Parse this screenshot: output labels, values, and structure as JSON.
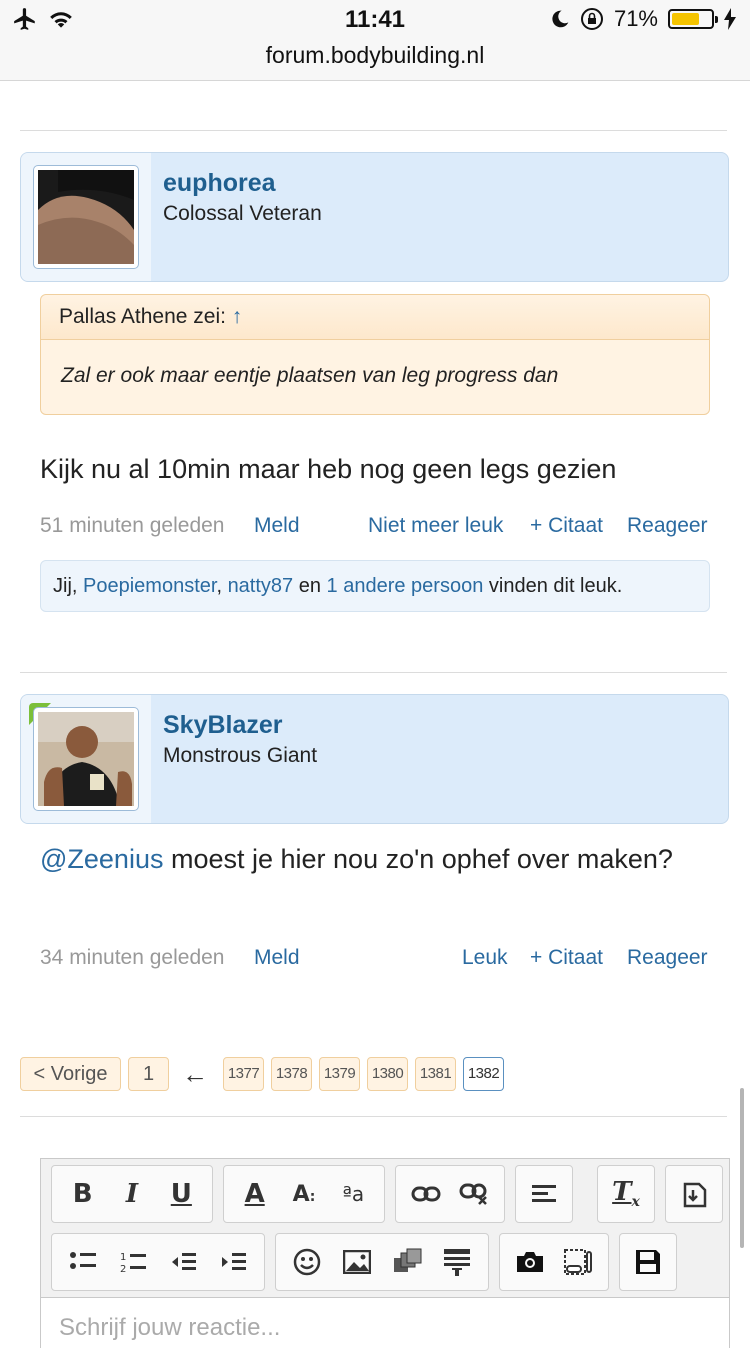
{
  "status_bar": {
    "time": "11:41",
    "battery_percent_label": "71%",
    "battery_level": 0.71
  },
  "browser": {
    "url": "forum.bodybuilding.nl"
  },
  "posts": [
    {
      "username": "euphorea",
      "user_title": "Colossal Veteran",
      "quote_author": "Pallas Athene zei:",
      "quote_arrow": "↑",
      "quote_text": "Zal er ook maar eentje plaatsen van leg progress dan",
      "text": "Kijk nu al 10min maar heb nog geen legs gezien",
      "time": "51 minuten geleden",
      "report": "Meld",
      "like": "Niet meer leuk",
      "quote_action": "+ Citaat",
      "reply": "Reageer",
      "likes": {
        "you": "Jij",
        "sep1": ", ",
        "user1": "Poepiemonster",
        "sep2": ", ",
        "user2": "natty87",
        "and": " en ",
        "others": "1 andere persoon",
        "suffix": " vinden dit leuk."
      }
    },
    {
      "username": "SkyBlazer",
      "user_title": "Monstrous Giant",
      "mention": "@Zeenius",
      "text": " moest je hier nou zo'n ophef over maken?",
      "time": "34 minuten geleden",
      "report": "Meld",
      "like": "Leuk",
      "quote_action": "+ Citaat",
      "reply": "Reageer"
    }
  ],
  "pagination": {
    "prev": "< Vorige",
    "first": "1",
    "arrow": "←",
    "pages": [
      "1377",
      "1378",
      "1379",
      "1380",
      "1381",
      "1382"
    ],
    "current": "1382"
  },
  "editor": {
    "placeholder": "Schrijf jouw reactie...",
    "tools_row1": [
      "bold-icon",
      "italic-icon",
      "underline-icon",
      "font-color-icon",
      "font-size-icon",
      "text-case-icon",
      "link-icon",
      "unlink-icon",
      "align-icon",
      "remove-format-icon",
      "paste-icon"
    ],
    "tools_row2": [
      "bullet-list-icon",
      "numbered-list-icon",
      "outdent-icon",
      "indent-icon",
      "smiley-icon",
      "image-icon",
      "media-icon",
      "code-block-icon",
      "camera-icon",
      "spoiler-icon",
      "save-icon"
    ]
  }
}
